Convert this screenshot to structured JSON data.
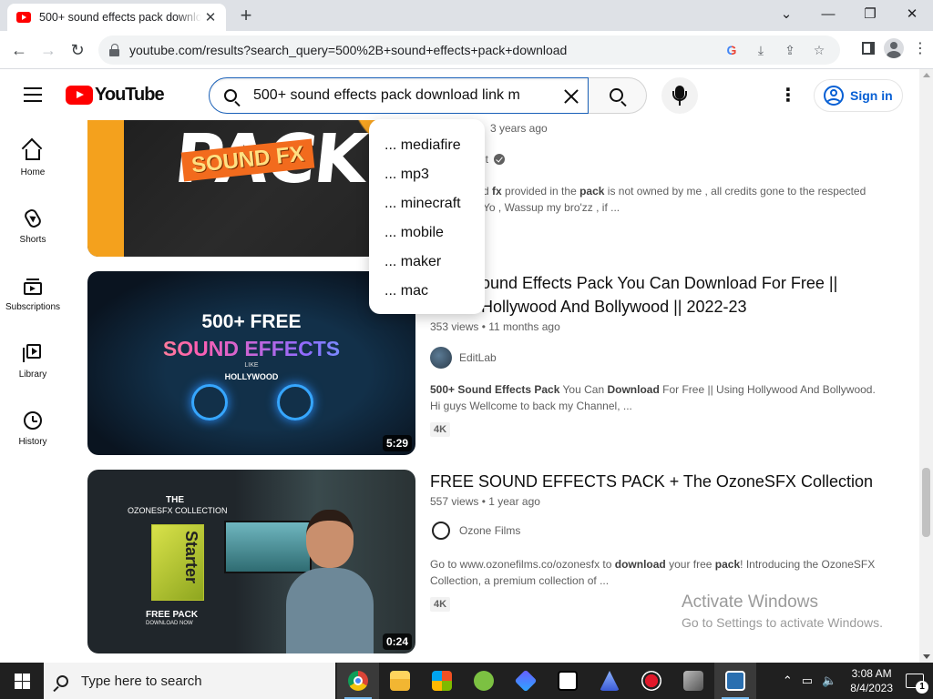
{
  "browser": {
    "tab_title": "500+ sound effects pack downlo",
    "tab_close": "✕",
    "new_tab": "+",
    "window_controls": {
      "minimize": "—",
      "maximize": "❐",
      "close": "✕",
      "dropdown": "⌄"
    },
    "nav": {
      "back": "←",
      "forward": "→",
      "reload": "↻"
    },
    "url": "youtube.com/results?search_query=500%2B+sound+effects+pack+download",
    "omnibox_icons": [
      "google-lens-icon",
      "install-icon",
      "share-icon",
      "bookmark-star-icon"
    ],
    "omnibox_glyphs": {
      "google": "G",
      "install": "⤓",
      "share": "⇪",
      "star": "☆"
    },
    "menu_glyph": "⋮"
  },
  "youtube": {
    "logo_text": "YouTube",
    "search_query": "500+ sound effects pack download link m",
    "kebab": "⋮",
    "sign_in": "Sign in"
  },
  "guide": [
    {
      "label": "Home",
      "icon": "home-icon"
    },
    {
      "label": "Shorts",
      "icon": "shorts-icon"
    },
    {
      "label": "Subscriptions",
      "icon": "subscriptions-icon"
    },
    {
      "label": "Library",
      "icon": "library-icon"
    },
    {
      "label": "History",
      "icon": "history-icon"
    }
  ],
  "suggestions": [
    "... mediafire",
    "... mp3",
    "... minecraft",
    "... mobile",
    "... maker",
    "... mac"
  ],
  "results": [
    {
      "thumb_big": "PACK",
      "thumb_sfx": "SOUND FX",
      "meta": "3 years ago",
      "channel": "it",
      "desc_parts": [
        "d ",
        "fx",
        " provided in the ",
        "pack",
        " is not owned by me , all credits gone to the respected"
      ],
      "desc_line2": "Yo , Wassup my bro'zz , if ..."
    },
    {
      "title": "ound Effects Pack You Can Download For Free || Hollywood And Bollywood || 2022-23",
      "thumb_l1": "500+ FREE",
      "thumb_l2": "SOUND EFFECTS",
      "thumb_l3": "LIKE",
      "thumb_l4": "HOLLYWOOD",
      "duration": "5:29",
      "views": "353 views",
      "age": "11 months ago",
      "channel": "EditLab",
      "desc_parts": [
        "500+ Sound Effects Pack",
        " You Can ",
        "Download",
        " For Free || Using Hollywood And Bollywood. Hi guys Wellcome to back my Channel, ..."
      ],
      "badge": "4K"
    },
    {
      "title": "FREE SOUND EFFECTS PACK + The OzoneSFX Collection",
      "thumb_t1": "THE",
      "thumb_t2": "OZONESFX COLLECTION",
      "thumb_box": "Starter",
      "thumb_fp": "FREE PACK",
      "thumb_dn": "DOWNLOAD NOW",
      "duration": "0:24",
      "views": "557 views",
      "age": "1 year ago",
      "channel": "Ozone Films",
      "desc_parts": [
        "Go to www.ozonefilms.co/ozonesfx to ",
        "download",
        " your free ",
        "pack",
        "! Introducing the OzoneSFX Collection, a premium collection of ..."
      ],
      "badge": "4K"
    }
  ],
  "watermark": {
    "line1": "Activate Windows",
    "line2": "Go to Settings to activate Windows."
  },
  "taskbar": {
    "search_placeholder": "Type here to search",
    "apps": [
      "chrome-icon",
      "file-explorer-icon",
      "store-icon",
      "app-green-icon",
      "app-blue-icon",
      "7zip-icon",
      "app-triangle-icon",
      "record-icon",
      "app-film-icon",
      "app-media-icon"
    ],
    "tray_glyphs": {
      "chevron": "⌃",
      "network": "▭",
      "volume": "🔈"
    },
    "time": "3:08 AM",
    "date": "8/4/2023",
    "notifications": "1"
  },
  "colors": {
    "youtube_red": "#ff0000",
    "link_blue": "#065fd4",
    "search_border": "#1c62b9"
  }
}
